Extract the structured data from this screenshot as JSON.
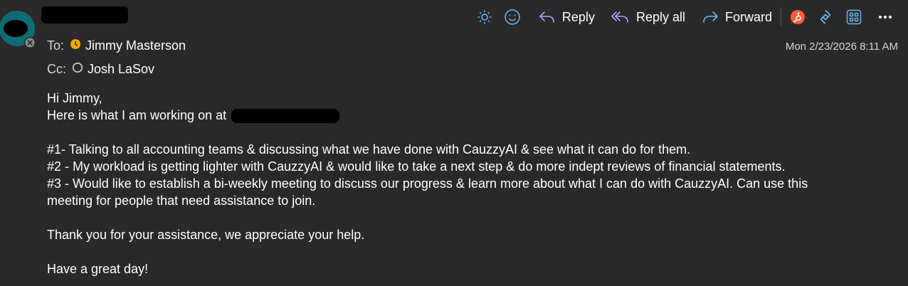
{
  "toolbar": {
    "brightness_icon": "sun-icon",
    "emoji_icon": "smiley-icon",
    "reply_label": "Reply",
    "reply_all_label": "Reply all",
    "forward_label": "Forward",
    "hubspot_icon": "hubspot-icon",
    "loop_icon": "loop-icon",
    "apps_icon": "apps-icon",
    "more_icon": "more-icon"
  },
  "header": {
    "to_key": "To:",
    "to_name": "Jimmy Masterson",
    "cc_key": "Cc:",
    "cc_name": "Josh LaSov",
    "date": "Mon 2/23/2026 8:11 AM"
  },
  "message": {
    "greeting": "Hi Jimmy,",
    "intro": "Here is what I am working on at",
    "item1": "#1- Talking to all accounting teams & discussing what we have done with CauzzyAI & see what it can do for them.",
    "item2": "#2 - My workload is getting lighter with CauzzyAI & would like to take a next step & do more indept reviews of financial statements.",
    "item3a": "#3 - Would like to establish a bi-weekly meeting to discuss our progress & learn more about what I can do with CauzzyAI. Can use this",
    "item3b": "meeting for people that need assistance to join.",
    "thanks": "Thank you for your assistance, we appreciate your help.",
    "closing": "Have a great day!"
  },
  "colors": {
    "background": "#292929",
    "accent_blue": "#6cb8f6",
    "reply_purple": "#b4a0ff",
    "away_yellow": "#f2a900",
    "hubspot_orange": "#ff5c35"
  }
}
